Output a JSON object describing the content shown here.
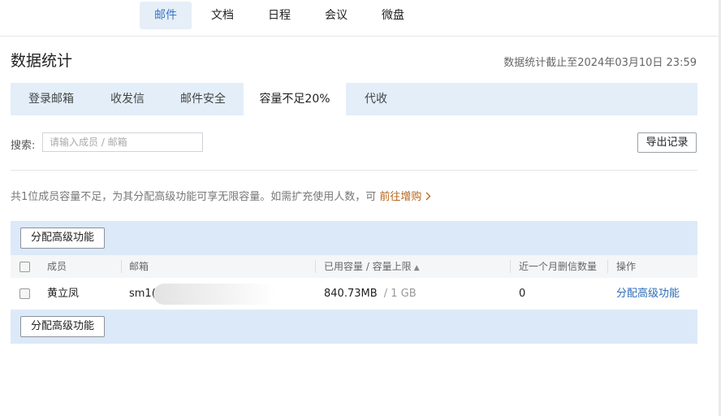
{
  "topnav": {
    "tabs": [
      "邮件",
      "文档",
      "日程",
      "会议",
      "微盘"
    ],
    "active_index": 0
  },
  "page": {
    "title": "数据统计",
    "stat_time": "数据统计截止至2024年03月10日 23:59"
  },
  "subtabs": {
    "items": [
      "登录邮箱",
      "收发信",
      "邮件安全",
      "容量不足20%",
      "代收"
    ],
    "active_index": 3
  },
  "search": {
    "label": "搜索:",
    "placeholder": "请输入成员 / 邮箱"
  },
  "export_label": "导出记录",
  "notice": {
    "text": "共1位成员容量不足，为其分配高级功能可享无限容量。如需扩充使用人数，可 ",
    "link": "前往增购"
  },
  "assign_button_label": "分配高级功能",
  "table": {
    "headers": {
      "member": "成员",
      "mailbox": "邮箱",
      "capacity": "已用容量 / 容量上限",
      "deleted": "近一个月删信数量",
      "action": "操作"
    },
    "rows": [
      {
        "member": "黄立凤",
        "mailbox": "sm1(",
        "used": "840.73MB",
        "limit": " / 1 GB",
        "deleted": "0",
        "action": "分配高级功能"
      }
    ]
  },
  "colors": {
    "accent": "#3a76c4",
    "band": "#dce9f8",
    "link_orange": "#b5651d"
  }
}
